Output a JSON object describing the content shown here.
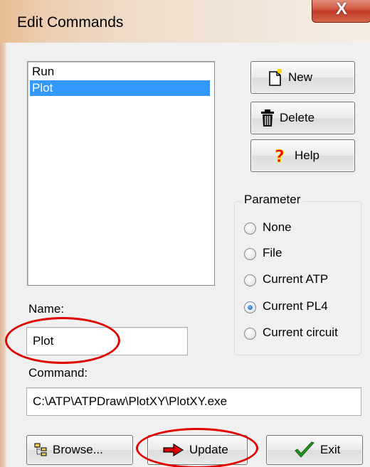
{
  "window": {
    "title": "Edit Commands",
    "close_glyph": "X"
  },
  "commands_list": {
    "items": [
      "Run",
      "Plot"
    ],
    "selected": "Plot"
  },
  "buttons": {
    "new_label": "New",
    "delete_label": "Delete",
    "help_label": "Help",
    "browse_label": "Browse...",
    "update_label": "Update",
    "exit_label": "Exit"
  },
  "parameter": {
    "title": "Parameter",
    "options": [
      "None",
      "File",
      "Current ATP",
      "Current PL4",
      "Current circuit"
    ],
    "selected": "Current PL4"
  },
  "name_field": {
    "label": "Name:",
    "value": "Plot"
  },
  "command_field": {
    "label": "Command:",
    "value": "C:\\ATP\\ATPDraw\\PlotXY\\PlotXY.exe"
  },
  "annotations": {
    "color": "#e00000",
    "circled": [
      "Name field",
      "Update button"
    ]
  },
  "icons": {
    "new": "new-document-icon",
    "delete": "trash-can-icon",
    "help": "question-mark-icon",
    "browse": "folder-tree-icon",
    "update": "red-arrow-icon",
    "exit": "green-checkmark-icon"
  },
  "colors": {
    "selection": "#3399ff",
    "title_gradient_start": "#e9bd92",
    "close_button": "#c03a24"
  }
}
